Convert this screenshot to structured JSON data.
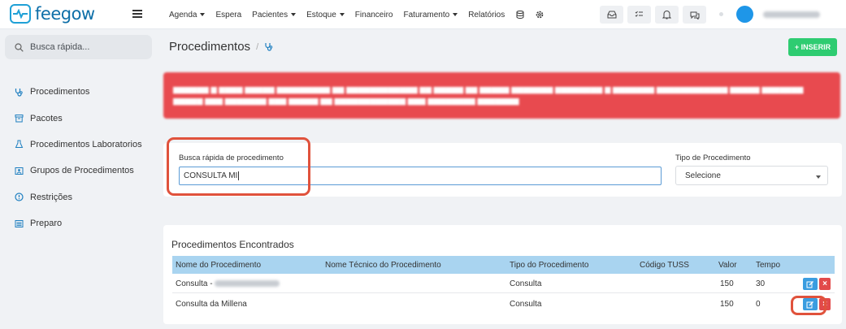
{
  "app": {
    "logo_text": "feegow"
  },
  "nav": {
    "items": [
      {
        "label": "Agenda",
        "dropdown": true
      },
      {
        "label": "Espera",
        "dropdown": false
      },
      {
        "label": "Pacientes",
        "dropdown": true
      },
      {
        "label": "Estoque",
        "dropdown": true
      },
      {
        "label": "Financeiro",
        "dropdown": false
      },
      {
        "label": "Faturamento",
        "dropdown": true
      },
      {
        "label": "Relatórios",
        "dropdown": false
      }
    ]
  },
  "sidebar": {
    "search_placeholder": "Busca rápida...",
    "items": [
      {
        "label": "Procedimentos",
        "icon": "stethoscope-icon"
      },
      {
        "label": "Pacotes",
        "icon": "package-icon"
      },
      {
        "label": "Procedimentos Laboratorios",
        "icon": "flask-icon"
      },
      {
        "label": "Grupos de Procedimentos",
        "icon": "group-icon"
      },
      {
        "label": "Restrições",
        "icon": "alert-circle-icon"
      },
      {
        "label": "Preparo",
        "icon": "list-icon"
      }
    ]
  },
  "page": {
    "title": "Procedimentos",
    "breadcrumb_sep": "/",
    "insert_label": "+ INSERIR"
  },
  "filters": {
    "search_label": "Busca rápida de procedimento",
    "search_value": "CONSULTA MI",
    "type_label": "Tipo de Procedimento",
    "type_value": "Selecione"
  },
  "results": {
    "title": "Procedimentos Encontrados",
    "columns": [
      "Nome do Procedimento",
      "Nome Técnico do Procedimento",
      "Tipo do Procedimento",
      "Código TUSS",
      "Valor",
      "Tempo"
    ],
    "rows": [
      {
        "name": "Consulta -",
        "technical": "",
        "type": "Consulta",
        "tuss": "",
        "valor": "150",
        "tempo": "30"
      },
      {
        "name": "Consulta da Millena",
        "technical": "",
        "type": "Consulta",
        "tuss": "",
        "valor": "150",
        "tempo": "0"
      }
    ]
  },
  "colors": {
    "brand": "#0e6fa8",
    "accent": "#1fa0d6",
    "insert": "#2ecc71",
    "alert": "#e84a4f",
    "table_header": "#a9d4f0",
    "highlight": "#e0523c"
  }
}
